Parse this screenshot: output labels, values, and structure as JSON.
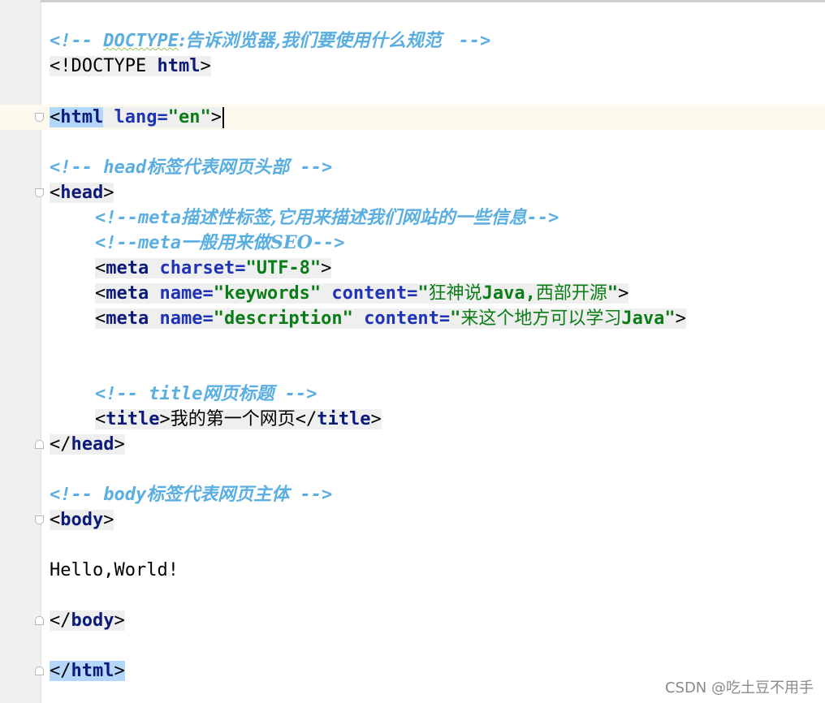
{
  "colors": {
    "comment": "#5aaee0",
    "tag": "#0c1a78",
    "attribute": "#1f33b5",
    "attribute_value": "#0a7d16",
    "selection": "#b4d6fb",
    "caret_line": "#fcfaed"
  },
  "editor": {
    "doctype_comment": {
      "open": "<!-- ",
      "keyword": "DOCTYPE",
      "text": ":告诉浏览器,我们要使用什么规范 ",
      "close": " -->"
    },
    "doctype_line": {
      "prefix": "<!DOCTYPE ",
      "keyword": "html",
      "suffix": ">"
    },
    "html_open": {
      "lt": "<",
      "tag": "html",
      "attr": "lang",
      "eq": "=",
      "value": "\"en\"",
      "gt": ">"
    },
    "head_comment": {
      "open": "<!-- ",
      "tag_word": "head",
      "text": "标签代表网页头部",
      "close": " -->"
    },
    "head_open": {
      "lt": "<",
      "tag": "head",
      "gt": ">"
    },
    "meta_comment_1": {
      "open": "<!--",
      "tag_word": "meta",
      "text": "描述性标签,它用来描述我们网站的一些信息",
      "close": "-->"
    },
    "meta_comment_2": {
      "open": "<!--",
      "tag_word": "meta",
      "text": "一般用来做",
      "seo": "SEO",
      "close": "-->"
    },
    "meta_charset": {
      "lt": "<",
      "tag": "meta",
      "attr": "charset",
      "eq": "=",
      "value": "\"UTF-8\"",
      "gt": ">"
    },
    "meta_keywords": {
      "lt": "<",
      "tag": "meta",
      "attr1": "name",
      "eq1": "=",
      "value1": "\"keywords\"",
      "attr2": "content",
      "eq2": "=",
      "value2_open": "\"",
      "value2_cjk": "狂神说",
      "value2_latin": "Java,",
      "value2_cjk2": "西部开源",
      "value2_close": "\"",
      "gt": ">"
    },
    "meta_description": {
      "lt": "<",
      "tag": "meta",
      "attr1": "name",
      "eq1": "=",
      "value1": "\"description\"",
      "attr2": "content",
      "eq2": "=",
      "value2_open": "\"",
      "value2_cjk": "来这个地方可以学习",
      "value2_latin": "Java",
      "value2_close": "\"",
      "gt": ">"
    },
    "title_comment": {
      "open": "<!-- ",
      "tag_word": "title",
      "text": "网页标题",
      "close": " -->"
    },
    "title_line": {
      "open_lt": "<",
      "open_tag": "title",
      "open_gt": ">",
      "text": "我的第一个网页",
      "close_lt": "</",
      "close_tag": "title",
      "close_gt": ">"
    },
    "head_close": {
      "lt": "</",
      "tag": "head",
      "gt": ">"
    },
    "body_comment": {
      "open": "<!-- ",
      "tag_word": "body",
      "text": "标签代表网页主体",
      "close": " -->"
    },
    "body_open": {
      "lt": "<",
      "tag": "body",
      "gt": ">"
    },
    "hello": "Hello,World!",
    "body_close": {
      "lt": "</",
      "tag": "body",
      "gt": ">"
    },
    "html_close": {
      "lt": "</",
      "tag": "html",
      "gt": ">"
    }
  },
  "watermark": "CSDN @吃土豆不用手"
}
